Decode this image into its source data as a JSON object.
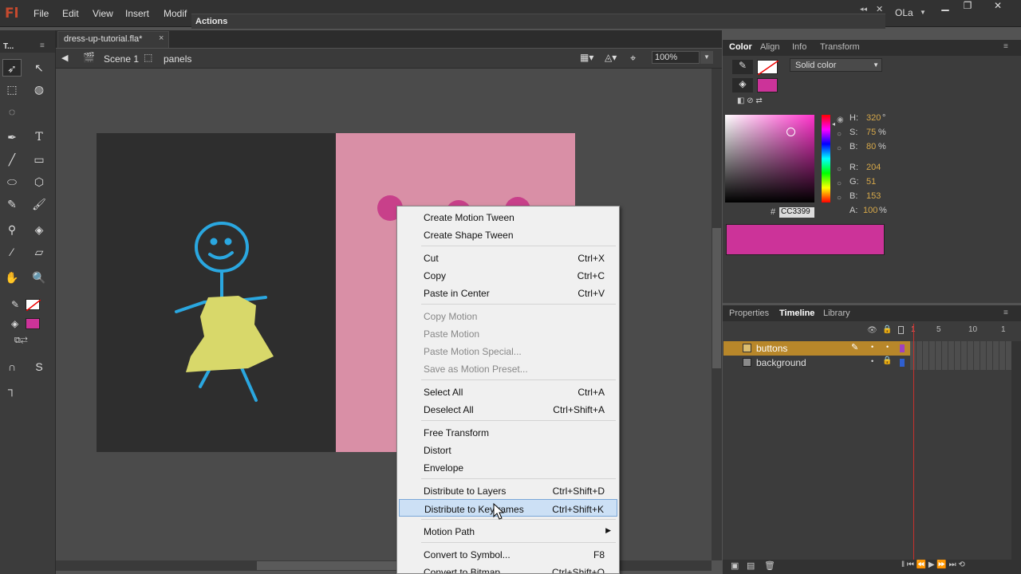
{
  "app": {
    "logo": "Fl",
    "menus": [
      "File",
      "Edit",
      "View",
      "Insert",
      "Modif"
    ],
    "actions_panel": "Actions",
    "user": "OLa"
  },
  "document": {
    "tab": "dress-up-tutorial.fla*",
    "close": "×"
  },
  "editbar": {
    "scene": "Scene 1",
    "symbol": "panels",
    "zoom": "100%"
  },
  "toolbar": {
    "title": "T..."
  },
  "color_panel": {
    "tabs": [
      "Color",
      "Align",
      "Info",
      "Transform"
    ],
    "type": "Solid color",
    "hsb": [
      {
        "label": "H:",
        "value": "320",
        "unit": "°"
      },
      {
        "label": "S:",
        "value": "75",
        "unit": "%"
      },
      {
        "label": "B:",
        "value": "80",
        "unit": "%"
      }
    ],
    "rgb": [
      {
        "label": "R:",
        "value": "204"
      },
      {
        "label": "G:",
        "value": "51"
      },
      {
        "label": "B:",
        "value": "153"
      }
    ],
    "hex_label": "#",
    "hex": "CC3399",
    "alpha": {
      "label": "A:",
      "value": "100",
      "unit": "%"
    },
    "color": "#cc3399"
  },
  "timeline": {
    "tabs": [
      "Properties",
      "Timeline",
      "Library"
    ],
    "frame_numbers": [
      "1",
      "5",
      "10",
      "1"
    ],
    "layers": [
      {
        "name": "buttons"
      },
      {
        "name": "background"
      }
    ]
  },
  "context_menu": {
    "items": [
      {
        "label": "Create Motion Tween",
        "shortcut": ""
      },
      {
        "label": "Create Shape Tween",
        "shortcut": ""
      },
      {
        "label": "Cut",
        "shortcut": "Ctrl+X"
      },
      {
        "label": "Copy",
        "shortcut": "Ctrl+C"
      },
      {
        "label": "Paste in Center",
        "shortcut": "Ctrl+V"
      },
      {
        "label": "Copy Motion",
        "shortcut": ""
      },
      {
        "label": "Paste Motion",
        "shortcut": ""
      },
      {
        "label": "Paste Motion Special...",
        "shortcut": ""
      },
      {
        "label": "Save as Motion Preset...",
        "shortcut": ""
      },
      {
        "label": "Select All",
        "shortcut": "Ctrl+A"
      },
      {
        "label": "Deselect All",
        "shortcut": "Ctrl+Shift+A"
      },
      {
        "label": "Free Transform",
        "shortcut": ""
      },
      {
        "label": "Distort",
        "shortcut": ""
      },
      {
        "label": "Envelope",
        "shortcut": ""
      },
      {
        "label": "Distribute to Layers",
        "shortcut": "Ctrl+Shift+D"
      },
      {
        "label": "Distribute to Keyframes",
        "shortcut": "Ctrl+Shift+K"
      },
      {
        "label": "Motion Path",
        "shortcut": ""
      },
      {
        "label": "Convert to Symbol...",
        "shortcut": "F8"
      },
      {
        "label": "Convert to Bitmap",
        "shortcut": "Ctrl+Shift+O"
      }
    ]
  }
}
